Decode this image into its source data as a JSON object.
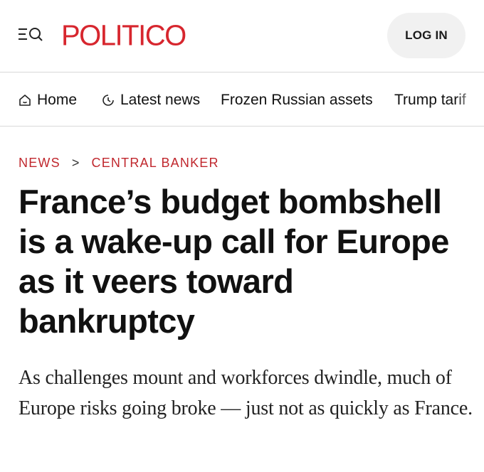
{
  "header": {
    "logo_text": "POLITICO",
    "login_label": "LOG IN",
    "menu_icon": "menu-search-icon",
    "brand_color": "#d7262e"
  },
  "nav": {
    "items": [
      {
        "label": "Home",
        "icon": "home-icon"
      },
      {
        "label": "Latest news",
        "icon": "clock-icon"
      },
      {
        "label": "Frozen Russian assets"
      },
      {
        "label": "Trump tarif"
      }
    ]
  },
  "breadcrumb": {
    "section": "NEWS",
    "separator": ">",
    "subsection": "CENTRAL BANKER",
    "color": "#c0272d"
  },
  "article": {
    "headline": "France’s budget bombshell is a wake-up call for Europe as it veers toward bankruptcy",
    "deck": "As challenges mount and workforces dwindle, much of Europe risks going broke — just not as quickly as France."
  }
}
